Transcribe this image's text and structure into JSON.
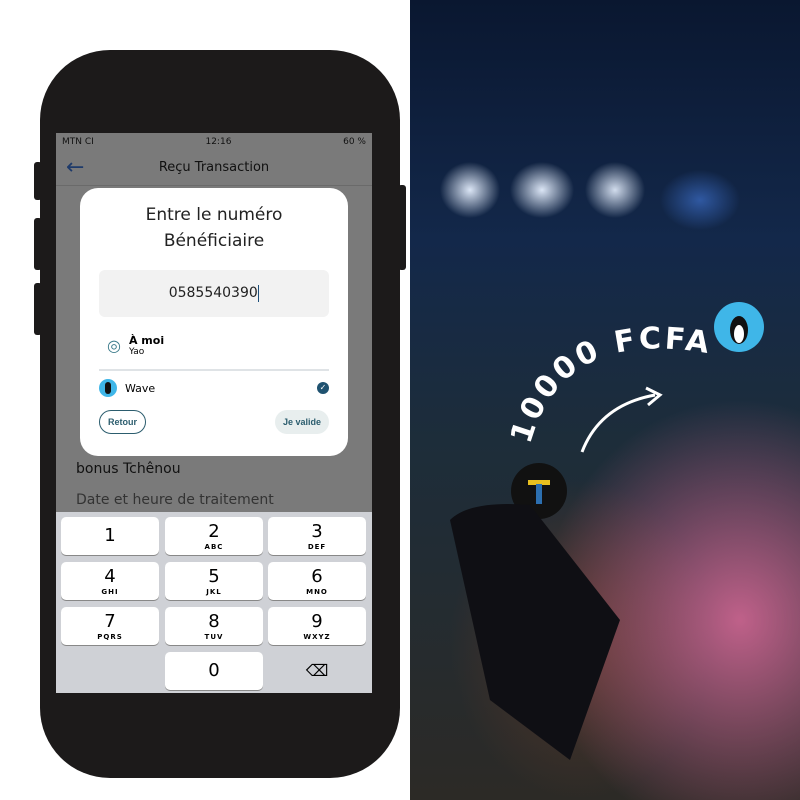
{
  "status": {
    "carrier": "MTN CI",
    "time": "12:16",
    "battery": "60 %"
  },
  "header": {
    "title": "Reçu Transaction"
  },
  "background": {
    "line1": "bonus Tchênou",
    "line2": "Date et heure de traitement"
  },
  "dialog": {
    "title_line1": "Entre le numéro",
    "title_line2": "Bénéficiaire",
    "phone_value": "0585540390",
    "contact_name": "À moi",
    "contact_sub": "Yao",
    "provider": "Wave",
    "provider_selected": true,
    "back_label": "Retour",
    "confirm_label": "Je valide"
  },
  "keypad": [
    {
      "n": "1",
      "l": ""
    },
    {
      "n": "2",
      "l": "ABC"
    },
    {
      "n": "3",
      "l": "DEF"
    },
    {
      "n": "4",
      "l": "GHI"
    },
    {
      "n": "5",
      "l": "JKL"
    },
    {
      "n": "6",
      "l": "MNO"
    },
    {
      "n": "7",
      "l": "PQRS"
    },
    {
      "n": "8",
      "l": "TUV"
    },
    {
      "n": "9",
      "l": "WXYZ"
    },
    {
      "n": "0",
      "l": ""
    }
  ],
  "promo": {
    "amount": "10000 FCFA"
  },
  "colors": {
    "accent": "#2c5d6e",
    "wave_blue": "#3fb6e8"
  }
}
